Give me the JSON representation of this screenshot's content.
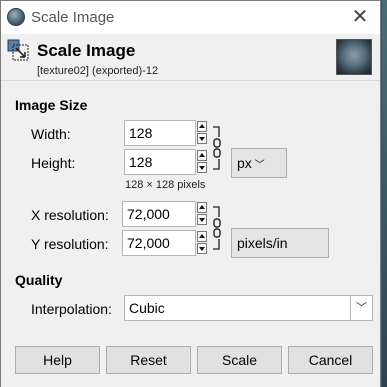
{
  "window": {
    "title": "Scale Image"
  },
  "header": {
    "title": "Scale Image",
    "subtitle": "[texture02] (exported)-12"
  },
  "image_size": {
    "section_title": "Image Size",
    "width_label": "Width:",
    "width_value": "128",
    "height_label": "Height:",
    "height_value": "128",
    "size_note": "128 × 128 pixels",
    "size_unit": "px",
    "xres_label": "X resolution:",
    "xres_value": "72,000",
    "yres_label": "Y resolution:",
    "yres_value": "72,000",
    "res_unit": "pixels/in"
  },
  "quality": {
    "section_title": "Quality",
    "interp_label": "Interpolation:",
    "interp_value": "Cubic"
  },
  "buttons": {
    "help": "Help",
    "reset": "Reset",
    "scale": "Scale",
    "cancel": "Cancel"
  },
  "icons": {
    "app": "gimp-icon",
    "close": "close-icon",
    "scale": "scale-image-icon",
    "chain": "chain-link-icon"
  }
}
